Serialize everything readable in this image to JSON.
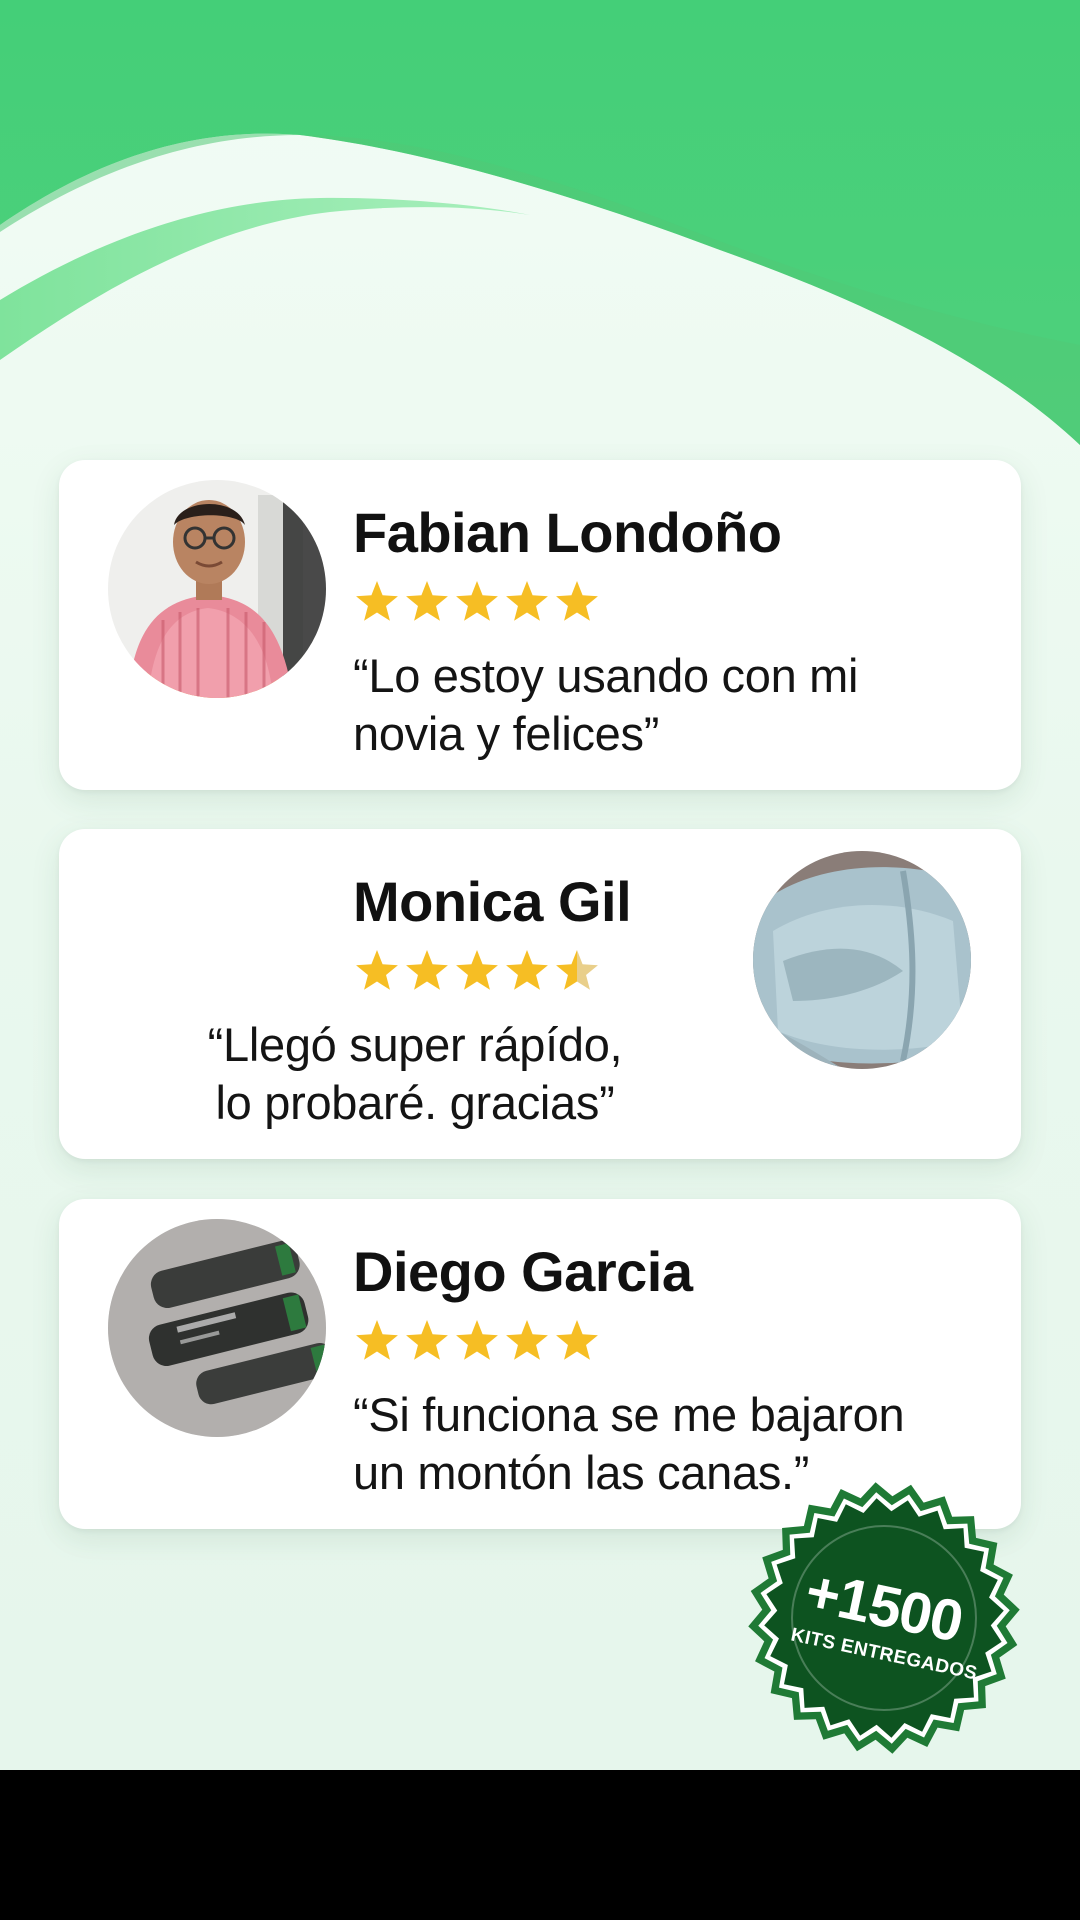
{
  "colors": {
    "wave_green": "#46cd76",
    "wave_light": "#7de49a",
    "star": "#f6be24",
    "badge_fill": "#0d5320",
    "badge_ring": "#1f7a35"
  },
  "reviews": [
    {
      "name": "Fabian Londoño",
      "rating": 5,
      "quote_line_1": "“Lo estoy usando con mi",
      "quote_line_2": "novia y felices”",
      "avatar_icon": "man-in-pink-shirt-photo"
    },
    {
      "name": "Monica Gil",
      "rating": 4.5,
      "quote_line_1": "“Llegó super rápído,",
      "quote_line_2": "lo probaré. gracias”",
      "avatar_icon": "light-blue-package-photo"
    },
    {
      "name": "Diego Garcia",
      "rating": 5,
      "quote_line_1": "“Si funciona se me bajaron",
      "quote_line_2": "un montón las canas.”",
      "avatar_icon": "spray-bottles-photo"
    }
  ],
  "badge": {
    "count": "+1500",
    "label": "KITS ENTREGADOS"
  }
}
